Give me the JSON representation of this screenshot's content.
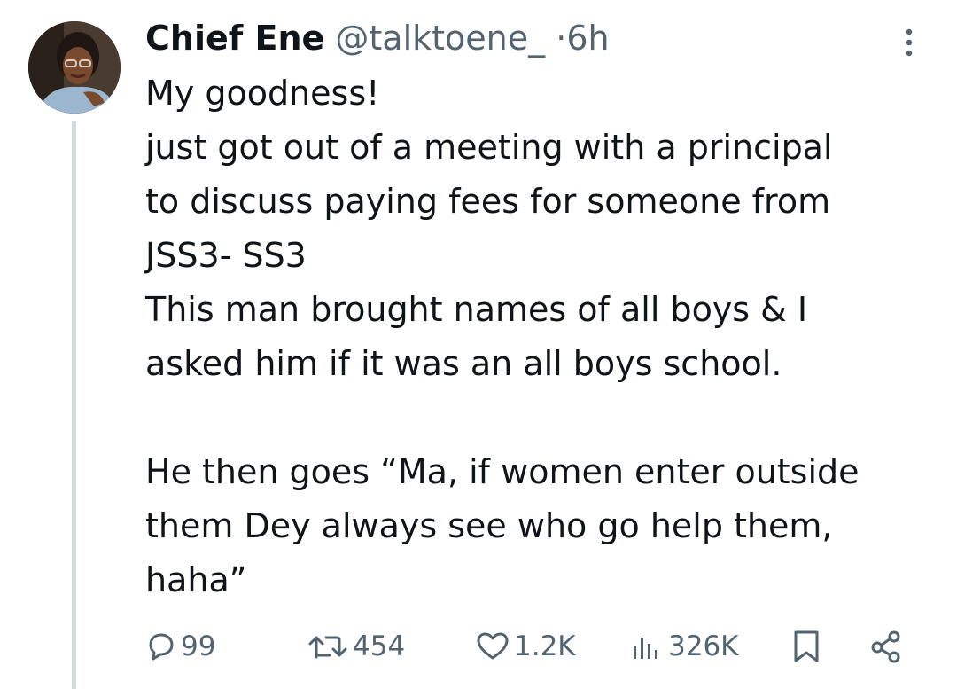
{
  "tweet": {
    "display_name": "Chief Ene",
    "handle": "@talktoene_",
    "separator": "·",
    "time": "6h",
    "lines": [
      "My goodness!",
      "just got out of a meeting with a principal",
      "to discuss paying fees for someone from",
      "JSS3- SS3",
      "This man brought names of all boys & I",
      "asked him if it was an all boys school.",
      "",
      "He then goes “Ma, if women enter outside",
      "them Dey always see who go help them,",
      "haha”"
    ]
  },
  "actions": {
    "replies": "99",
    "reposts": "454",
    "likes": "1.2K",
    "views": "326K"
  },
  "icons": {
    "reply": "reply-icon",
    "repost": "repost-icon",
    "like": "like-icon",
    "views": "views-icon",
    "bookmark": "bookmark-icon",
    "share": "share-icon",
    "more": "more-icon"
  },
  "colors": {
    "text": "#0f1419",
    "secondary": "#536471",
    "thread_line": "#cfd9de"
  }
}
